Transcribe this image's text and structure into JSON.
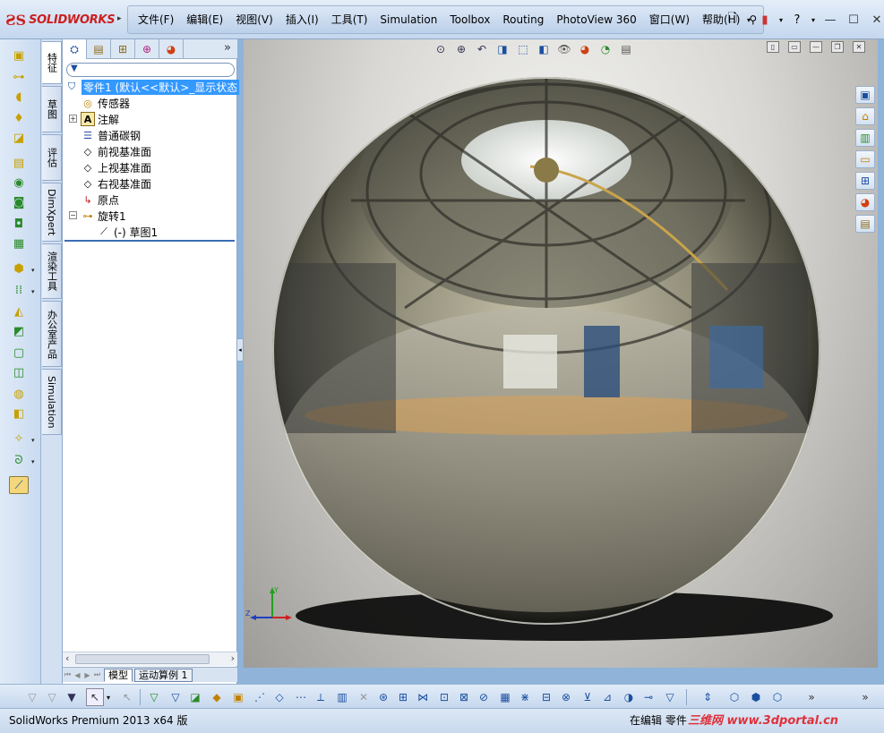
{
  "app": {
    "logo_text": "SOLIDWORKS",
    "menu": [
      "文件(F)",
      "编辑(E)",
      "视图(V)",
      "插入(I)",
      "工具(T)",
      "Simulation",
      "Toolbox",
      "Routing",
      "PhotoView 360",
      "窗口(W)",
      "帮助(H)"
    ]
  },
  "left_tabs": [
    "特征",
    "草图",
    "评估",
    "DimXpert",
    "渲染工具",
    "办公室产品",
    "Simulation"
  ],
  "feature_manager": {
    "tree": [
      {
        "label": "零件1  (默认<<默认>_显示状态",
        "icon": "part-icon",
        "selected": true
      },
      {
        "label": "传感器",
        "icon": "sensor-icon"
      },
      {
        "label": "注解",
        "icon": "annotation-icon"
      },
      {
        "label": "普通碳钢",
        "icon": "material-icon"
      },
      {
        "label": "前视基准面",
        "icon": "plane-icon"
      },
      {
        "label": "上视基准面",
        "icon": "plane-icon"
      },
      {
        "label": "右视基准面",
        "icon": "plane-icon"
      },
      {
        "label": "原点",
        "icon": "origin-icon"
      },
      {
        "label": "旋转1",
        "icon": "revolve-icon"
      },
      {
        "label": "(-) 草图1",
        "icon": "sketch-icon"
      }
    ]
  },
  "bottom_tabs": {
    "model": "模型",
    "motion": "运动算例 1"
  },
  "status": {
    "left": "SolidWorks Premium 2013 x64 版",
    "right": "在编辑 零件",
    "watermark_name": "三维网",
    "watermark_url": "www.3dportal.cn"
  },
  "colors": {
    "accent": "#3399ff",
    "brand": "#cc1f1f",
    "watermark": "#e0303a"
  }
}
